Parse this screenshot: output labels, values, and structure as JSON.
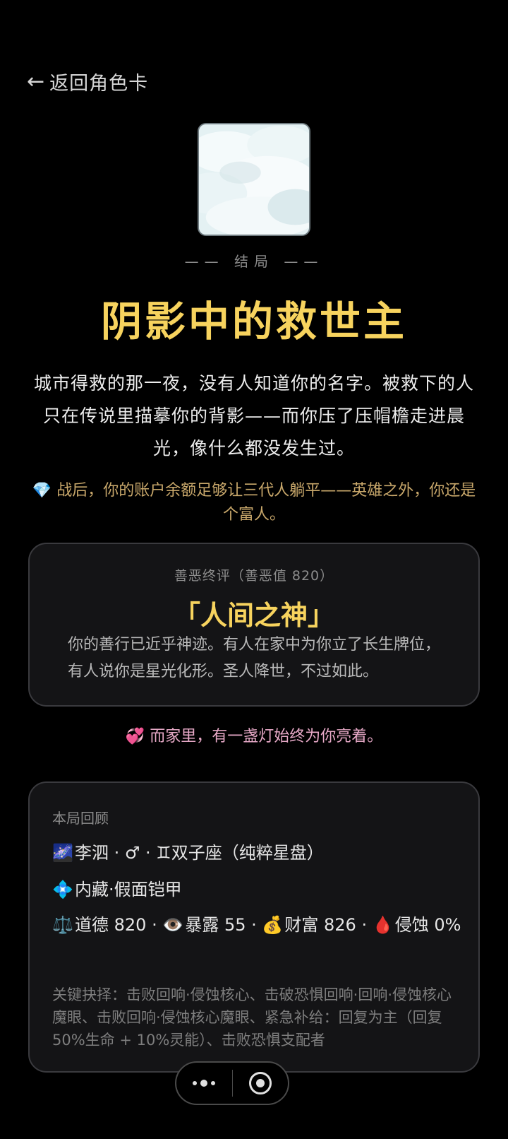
{
  "nav": {
    "back_arrow": "←",
    "back_label": "返回角色卡"
  },
  "ending": {
    "cover_icon": "cloud-image",
    "subtag": "—— 结局 ——",
    "title": "阴影中的救世主",
    "narrative": "城市得救的那一夜，没有人知道你的名字。被救下的人只在传说里描摹你的背影——而你压了压帽檐走进晨光，像什么都没发生过。",
    "wealth_icon": "💎",
    "wealth_text": "战后，你的账户余额足够让三代人躺平——英雄之外，你还是个富人。"
  },
  "judgement": {
    "header": "善恶终评（善恶值 820）",
    "title": "「人间之神」",
    "text": "你的善行已近乎神迹。有人在家中为你立了长生牌位，有人说你是星光化形。圣人降世，不过如此。"
  },
  "family": {
    "icon": "💞",
    "text": "而家里，有一盏灯始终为你亮着。"
  },
  "recap": {
    "header": "本局回顾",
    "identity_icon": "🌌",
    "identity": "李泗 · ♂ · ♊双子座（纯粹星盘）",
    "trait_icon": "💠",
    "trait": "内藏·假面铠甲",
    "stats": {
      "morality_icon": "⚖️",
      "morality": "道德 820",
      "sep1": " · ",
      "exposure_icon": "👁️",
      "exposure": "暴露 55",
      "sep2": " · ",
      "wealth_icon": "💰",
      "wealth": "财富 826",
      "sep3": " · ",
      "corruption_icon": "🩸",
      "corruption": "侵蚀 0%"
    },
    "key_choices": "关键抉择：击败回响·侵蚀核心、击破恐惧回响·回响·侵蚀核心魔眼、击败回响·侵蚀核心魔眼、紧急补给：回复为主（回复50%生命 + 10%灵能）、击败恐惧支配者"
  },
  "capsule": {
    "more_icon": "more-dots-icon",
    "close_icon": "target-circle-icon"
  }
}
